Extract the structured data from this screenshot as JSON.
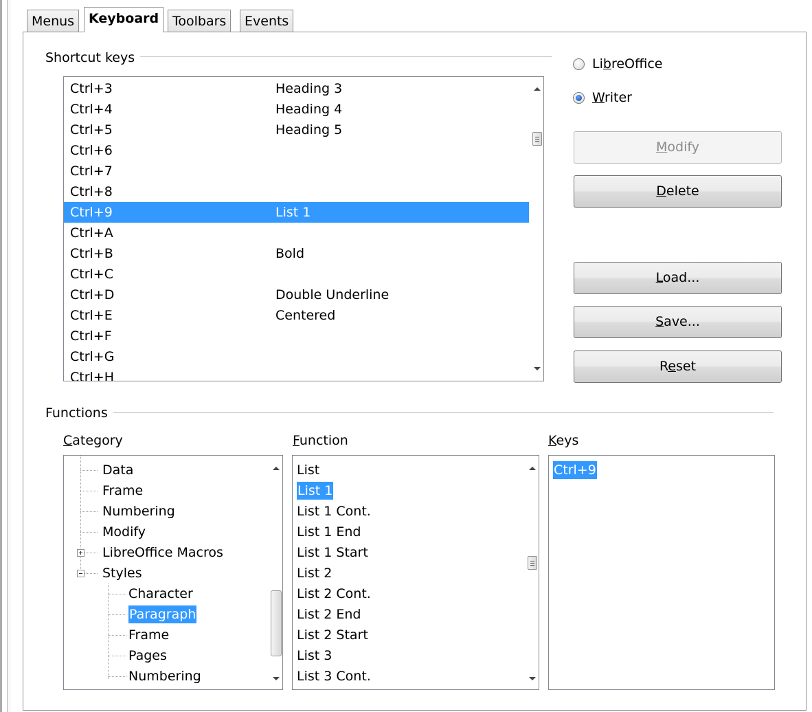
{
  "tabs": [
    {
      "label": "Menus",
      "active": false
    },
    {
      "label": "Keyboard",
      "active": true
    },
    {
      "label": "Toolbars",
      "active": false
    },
    {
      "label": "Events",
      "active": false
    }
  ],
  "shortcut_group": {
    "title": "Shortcut keys"
  },
  "shortcuts": [
    {
      "key": "Ctrl+3",
      "command": "Heading 3"
    },
    {
      "key": "Ctrl+4",
      "command": "Heading 4"
    },
    {
      "key": "Ctrl+5",
      "command": "Heading 5"
    },
    {
      "key": "Ctrl+6",
      "command": ""
    },
    {
      "key": "Ctrl+7",
      "command": ""
    },
    {
      "key": "Ctrl+8",
      "command": ""
    },
    {
      "key": "Ctrl+9",
      "command": "List 1",
      "selected": true
    },
    {
      "key": "Ctrl+A",
      "command": ""
    },
    {
      "key": "Ctrl+B",
      "command": "Bold"
    },
    {
      "key": "Ctrl+C",
      "command": ""
    },
    {
      "key": "Ctrl+D",
      "command": "Double Underline"
    },
    {
      "key": "Ctrl+E",
      "command": "Centered"
    },
    {
      "key": "Ctrl+F",
      "command": ""
    },
    {
      "key": "Ctrl+G",
      "command": ""
    },
    {
      "key": "Ctrl+H",
      "command": ""
    }
  ],
  "scope": {
    "libreoffice": {
      "pre": "Li",
      "u": "b",
      "post": "reOffice",
      "checked": false
    },
    "writer": {
      "pre": "",
      "u": "W",
      "post": "riter",
      "checked": true
    }
  },
  "buttons": {
    "modify": {
      "pre": "",
      "u": "M",
      "post": "odify",
      "enabled": false
    },
    "delete": {
      "pre": "",
      "u": "D",
      "post": "elete",
      "enabled": true
    },
    "load": {
      "pre": "",
      "u": "L",
      "post": "oad...",
      "enabled": true
    },
    "save": {
      "pre": "",
      "u": "S",
      "post": "ave...",
      "enabled": true
    },
    "reset": {
      "pre": "R",
      "u": "e",
      "post": "set",
      "enabled": true
    }
  },
  "functions_group": {
    "title": "Functions"
  },
  "category": {
    "label_u": "C",
    "label_rest": "ategory",
    "items": [
      {
        "text": "Data"
      },
      {
        "text": "Frame"
      },
      {
        "text": "Numbering"
      },
      {
        "text": "Modify"
      },
      {
        "text": "LibreOffice Macros",
        "expander": "plus"
      },
      {
        "text": "Styles",
        "expander": "minus"
      },
      {
        "text": "Character"
      },
      {
        "text": "Paragraph",
        "selected": true
      },
      {
        "text": "Frame"
      },
      {
        "text": "Pages"
      },
      {
        "text": "Numbering"
      }
    ]
  },
  "function": {
    "label_u": "F",
    "label_rest": "unction",
    "items": [
      {
        "text": "List"
      },
      {
        "text": "List 1",
        "selected": true
      },
      {
        "text": "List 1 Cont."
      },
      {
        "text": "List 1 End"
      },
      {
        "text": "List 1 Start"
      },
      {
        "text": "List 2"
      },
      {
        "text": "List 2 Cont."
      },
      {
        "text": "List 2 End"
      },
      {
        "text": "List 2 Start"
      },
      {
        "text": "List 3"
      },
      {
        "text": "List 3 Cont."
      }
    ]
  },
  "keys": {
    "label_u": "K",
    "label_rest": "eys",
    "items": [
      {
        "text": "Ctrl+9",
        "selected": true
      }
    ]
  },
  "colors": {
    "selection": "#3399ff",
    "border": "#828790"
  }
}
